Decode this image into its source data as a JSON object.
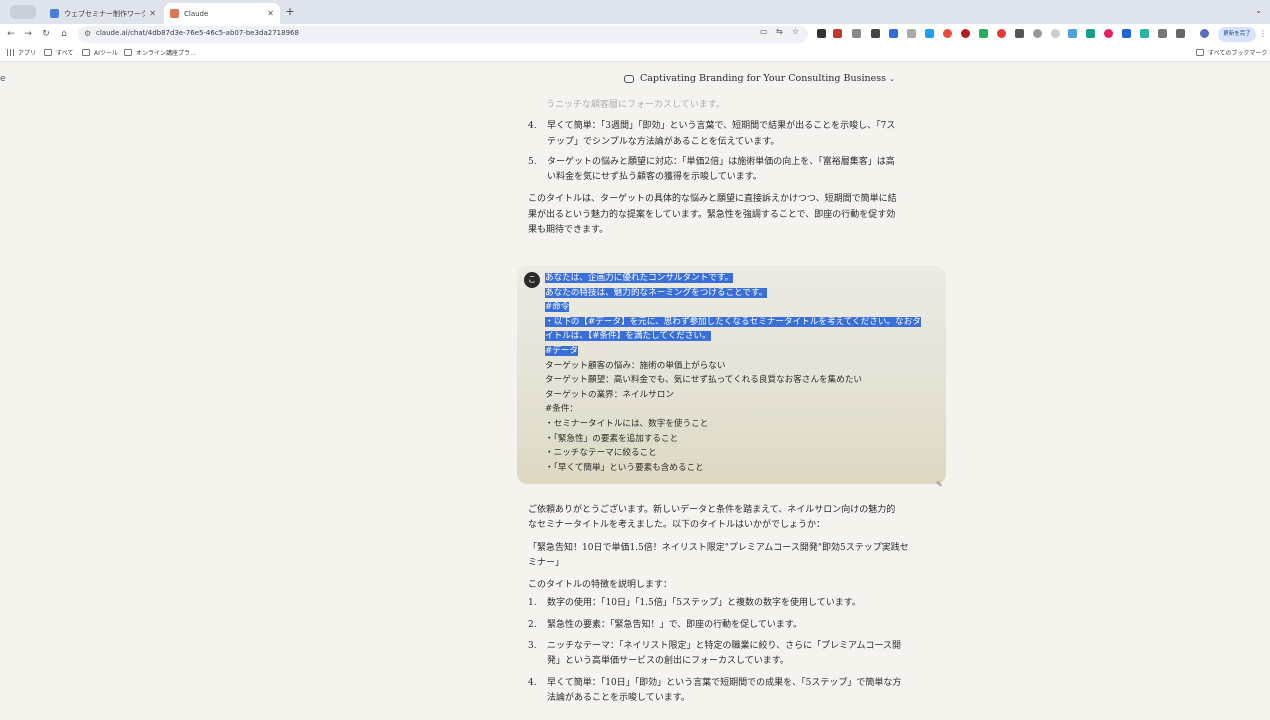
{
  "browser": {
    "tabs": [
      {
        "title": "ウェブセミナー制作ワークシート",
        "active": false
      },
      {
        "title": "Claude",
        "active": true
      }
    ],
    "url": "claude.ai/chat/4db87d3e-76e5-46c5-ab07-be3da2718968",
    "update_label": "更新を完了",
    "bookmarks": [
      "アプリ",
      "すべて",
      "AIツール",
      "オンライン講座プラ…"
    ],
    "all_bookmarks_label": "すべてのブックマーク"
  },
  "conversation": {
    "title": "Captivating Branding for Your Consulting Business",
    "prev_response": {
      "faded_line": "うニッチな顧客層にフォーカスしています。",
      "items": [
        {
          "num": "4.",
          "text": "早くて簡単：「3週間」「即効」という言葉で、短期間で結果が出ることを示唆し、「7ス",
          "cont": "テップ」でシンプルな方法論があることを伝えています。"
        },
        {
          "num": "5.",
          "text": "ターゲットの悩みと願望に対応：「単価2倍」は施術単価の向上を、「富裕層集客」は高",
          "cont": "い料金を気にせず払う顧客の獲得を示唆しています。"
        }
      ],
      "summary": [
        "このタイトルは、ターゲットの具体的な悩みと願望に直接訴えかけつつ、短期間で簡単に結",
        "果が出るという魅力的な提案をしています。緊急性を強調することで、即座の行動を促す効",
        "果も期待できます。"
      ]
    },
    "user_message": {
      "avatar": "こ",
      "lines": [
        {
          "text": "あなたは、企画力に優れたコンサルタントです。",
          "selected": true
        },
        {
          "text": "あなたの特技は、魅力的なネーミングをつけることです。",
          "selected": true
        },
        {
          "text": "#命令",
          "selected": true
        },
        {
          "text": "・以下の【#データ】を元に、思わず参加したくなるセミナータイトルを考えてください。なおタ",
          "selected": true
        },
        {
          "text": "イトルは、【#条件】を満たしてください。",
          "selected": true
        },
        {
          "text": "#データ",
          "selected": true
        },
        {
          "text": "ターゲット顧客の悩み：施術の単価上がらない",
          "selected": false
        },
        {
          "text": "ターゲット願望：高い料金でも、気にせず払ってくれる良質なお客さんを集めたい",
          "selected": false
        },
        {
          "text": "ターゲットの業界：ネイルサロン",
          "selected": false
        },
        {
          "text": "#条件：",
          "selected": false
        },
        {
          "text": "・セミナータイトルには、数字を使うこと",
          "selected": false
        },
        {
          "text": "・「緊急性」の要素を追加すること",
          "selected": false
        },
        {
          "text": "・ニッチなテーマに絞ること",
          "selected": false
        },
        {
          "text": "・「早くて簡単」という要素も含めること",
          "selected": false
        }
      ]
    },
    "response": {
      "intro": [
        "ご依頼ありがとうございます。新しいデータと条件を踏まえて、ネイルサロン向けの魅力的",
        "なセミナータイトルを考えました。以下のタイトルはいかがでしょうか："
      ],
      "title_lines": [
        "「緊急告知！10日で単価1.5倍！ネイリスト限定\"プレミアムコース開発\"即効5ステップ実践セ",
        "ミナー」"
      ],
      "features_heading": "このタイトルの特徴を説明します：",
      "items": [
        {
          "num": "1.",
          "text": "数字の使用：「10日」「1.5倍」「5ステップ」と複数の数字を使用しています。",
          "cont": ""
        },
        {
          "num": "2.",
          "text": "緊急性の要素：「緊急告知！」で、即座の行動を促しています。",
          "cont": ""
        },
        {
          "num": "3.",
          "text": "ニッチなテーマ：「ネイリスト限定」と特定の職業に絞り、さらに「プレミアムコース開",
          "cont": "発」という高単価サービスの創出にフォーカスしています。"
        },
        {
          "num": "4.",
          "text": "早くて簡単：「10日」「即効」という言葉で短期間での成果を、「5ステップ」で簡単な方",
          "cont": "法論があることを示唆しています。"
        }
      ]
    }
  }
}
